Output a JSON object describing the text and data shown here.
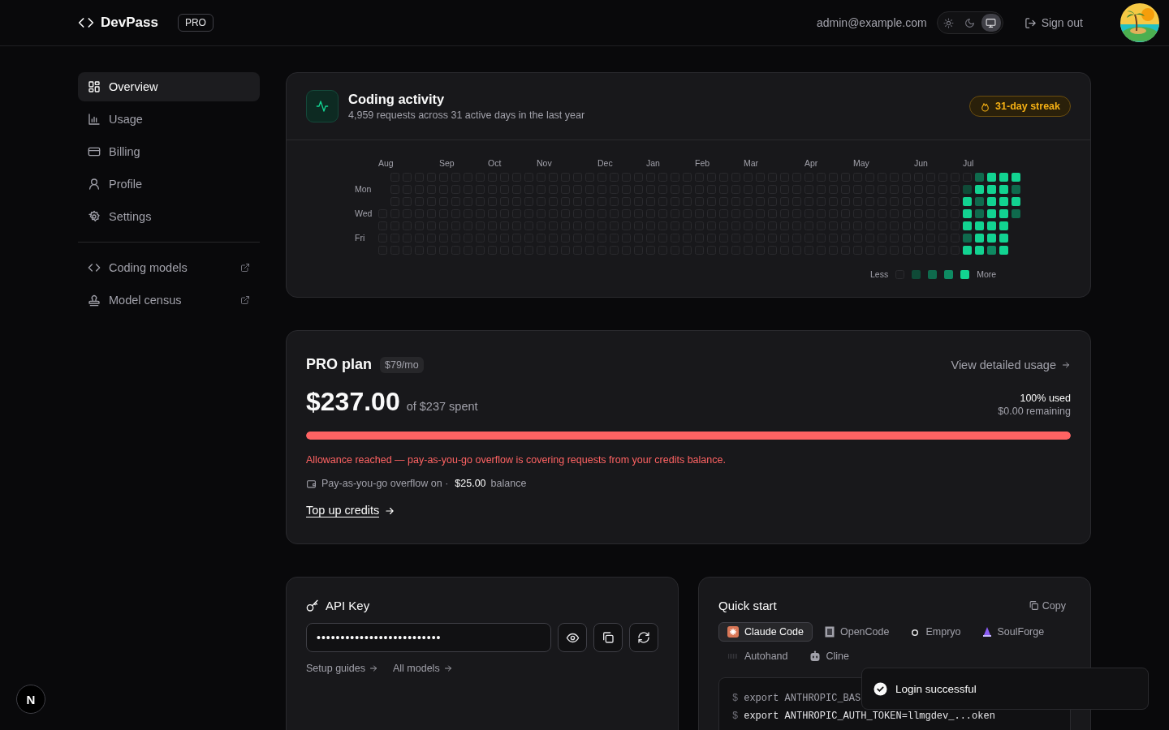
{
  "header": {
    "brand": "DevPass",
    "plan_badge": "PRO",
    "email": "admin@example.com",
    "theme_options": [
      {
        "kind": "light",
        "selected": false
      },
      {
        "kind": "dark",
        "selected": false
      },
      {
        "kind": "system",
        "selected": true
      }
    ],
    "sign_out": "Sign out"
  },
  "sidebar": {
    "items": [
      {
        "label": "Overview",
        "selected": true
      },
      {
        "label": "Usage",
        "selected": false
      },
      {
        "label": "Billing",
        "selected": false
      },
      {
        "label": "Profile",
        "selected": false
      },
      {
        "label": "Settings",
        "selected": false
      }
    ],
    "links": [
      {
        "label": "Coding models"
      },
      {
        "label": "Model census"
      }
    ]
  },
  "activity": {
    "title": "Coding activity",
    "subtitle": "4,959 requests across 31 active days in the last year",
    "streak": "31-day streak",
    "months": [
      "Aug",
      "Sep",
      "Oct",
      "Nov",
      "Dec",
      "Jan",
      "Feb",
      "Mar",
      "Apr",
      "May",
      "Jun",
      "Jul"
    ],
    "day_labels": [
      "Mon",
      "Wed",
      "Fri"
    ],
    "legend_less": "Less",
    "legend_more": "More"
  },
  "plan": {
    "title": "PRO plan",
    "price": "$79/mo",
    "details_link": "View detailed usage",
    "amount": "$237.00",
    "amount_note": "of $237 spent",
    "used": "100% used",
    "remaining": "$0.00 remaining",
    "level": 1,
    "warning": "Allowance reached — pay-as-you-go overflow is covering requests from your credits balance.",
    "overflow_label": "Pay-as-you-go overflow on ·",
    "balance": "$25.00",
    "balance_label": "balance",
    "top_up": "Top up credits"
  },
  "api_key": {
    "title": "API Key",
    "value": "••••••••••••••••••••••••••",
    "links": [
      "Setup guides",
      "All models"
    ]
  },
  "quick_start": {
    "title": "Quick start",
    "copy": "Copy",
    "tools": [
      {
        "label": "Claude Code",
        "kind": "claude",
        "selected": true
      },
      {
        "label": "OpenCode",
        "kind": "opencode",
        "selected": false
      },
      {
        "label": "Empryo",
        "kind": "empryo",
        "selected": false
      },
      {
        "label": "SoulForge",
        "kind": "soulforge",
        "selected": false
      },
      {
        "label": "Autohand",
        "kind": "autohand",
        "selected": false
      },
      {
        "label": "Cline",
        "kind": "cline",
        "selected": false
      }
    ],
    "code": [
      {
        "prompt": "$",
        "command": "export ANTHROPIC_BAS"
      },
      {
        "prompt": "$",
        "command": "export ANTHROPIC_AUTH_TOKEN=llmgdev_...oken"
      }
    ]
  },
  "toast": {
    "message": "Login successful"
  },
  "dev_badge": "N"
}
